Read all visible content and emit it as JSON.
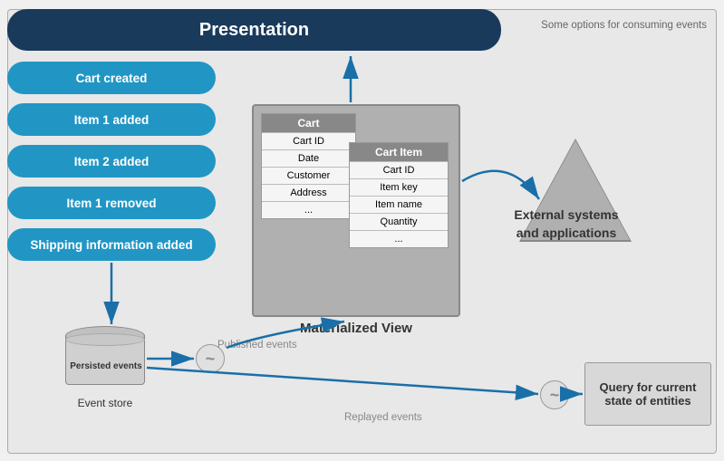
{
  "diagram": {
    "title": "Some options for consuming events",
    "presentation": {
      "label": "Presentation"
    },
    "events": [
      {
        "label": "Cart created"
      },
      {
        "label": "Item 1 added"
      },
      {
        "label": "Item 2 added"
      },
      {
        "label": "Item 1 removed"
      },
      {
        "label": "Shipping information added"
      }
    ],
    "cylinder": {
      "label": "Persisted events",
      "store_label": "Event store"
    },
    "materialized_view": {
      "label": "Materialized View",
      "cart_table": {
        "header": "Cart",
        "rows": [
          "Cart ID",
          "Date",
          "Customer",
          "Address",
          "..."
        ]
      },
      "cart_item_table": {
        "header": "Cart Item",
        "rows": [
          "Cart ID",
          "Item key",
          "Item name",
          "Quantity",
          "..."
        ]
      }
    },
    "external": {
      "label": "External systems and applications"
    },
    "query": {
      "label": "Query for current state of entities"
    },
    "published_events": "Published events",
    "replayed_events": "Replayed events"
  }
}
